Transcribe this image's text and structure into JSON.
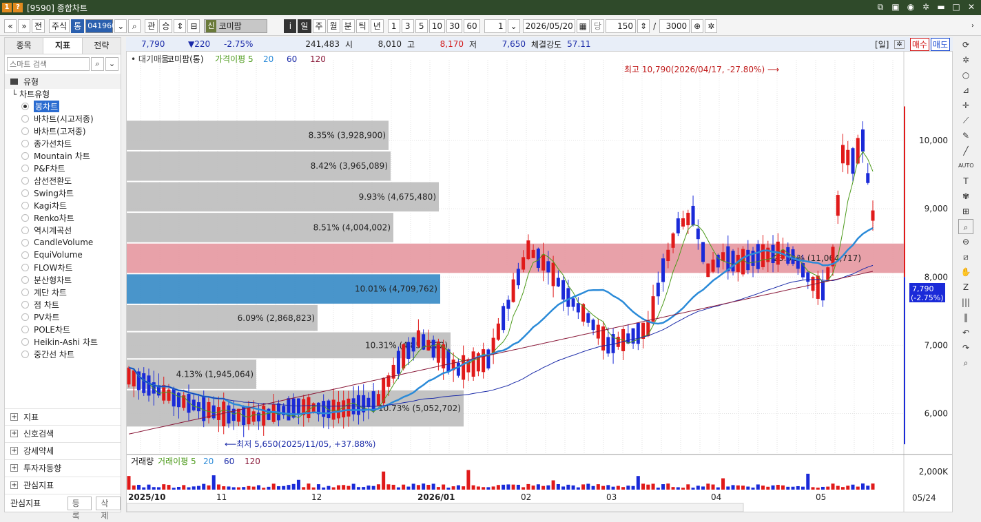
{
  "window": {
    "title": "[9590] 종합차트",
    "icon1": "1",
    "icon2": "?",
    "buttons": [
      "restore-icon",
      "image-icon",
      "camera-icon",
      "gear-icon",
      "minimize-icon",
      "maximize-icon",
      "close-icon"
    ]
  },
  "toolbar": {
    "prev": "«",
    "down": "»",
    "jeon": "전",
    "stock_type": "주식",
    "tong": "통",
    "code": "041960",
    "gwan": "관",
    "seung": "승",
    "tag": "신",
    "stock_name": "코미팜",
    "info": "i",
    "periods": [
      "일",
      "주",
      "월",
      "분",
      "틱",
      "년"
    ],
    "active_period": "일",
    "minutes": [
      "1",
      "3",
      "5",
      "10",
      "30",
      "60"
    ],
    "interval": "1",
    "date": "2026/05/20",
    "dang": "당",
    "count": "150",
    "slash": "/",
    "total": "3000"
  },
  "left": {
    "tabs": [
      "종목",
      "지표",
      "전략"
    ],
    "active_tab": "지표",
    "search_placeholder": "스마트 검색",
    "group": "유형",
    "tree_title": "차트유형",
    "chart_types": [
      "봉차트",
      "바차트(시고저종)",
      "바차트(고저종)",
      "종가선차트",
      "Mountain 차트",
      "P&F차트",
      "삼선전환도",
      "Swing차트",
      "Kagi차트",
      "Renko차트",
      "역시계곡선",
      "CandleVolume",
      "EquiVolume",
      "FLOW차트",
      "분산형차트",
      "계단 차트",
      "점 차트",
      "PV차트",
      "POLE차트",
      "Heikin-Ashi 차트",
      "중간선 차트"
    ],
    "selected_type": "봉차트",
    "bottom_groups": [
      "지표",
      "신호검색",
      "강세약세",
      "투자자동향",
      "관심지표"
    ],
    "footer_label": "관심지표",
    "btn_register": "등록",
    "btn_delete": "삭제"
  },
  "quote": {
    "price": "7,790",
    "change": "▼220",
    "rate": "-2.75%",
    "volume": "241,483",
    "open_label": "시",
    "open": "8,010",
    "high_label": "고",
    "high": "8,170",
    "low_label": "저",
    "low": "7,650",
    "strength_label": "체결강도",
    "strength": "57.11",
    "period_label": "[일]",
    "buy": "매수",
    "sell": "매도"
  },
  "chart_data": {
    "type": "candlestick",
    "legend": [
      "대기매물",
      "코미팜(통)",
      "가격이평 5",
      "20",
      "60",
      "120"
    ],
    "legend_colors": [
      "#333333",
      "#111111",
      "#4c9a1a",
      "#2a8ad8",
      "#1a2aa8",
      "#8a1a3a"
    ],
    "volume_legend": [
      "거래량",
      "거래이평 5",
      "20",
      "60",
      "120"
    ],
    "y_ticks": [
      10000,
      9000,
      8000,
      7000,
      6000
    ],
    "y_tick_labels": [
      "10,000",
      "9,000",
      "8,000",
      "7,000",
      "6,000"
    ],
    "vol_tick_label": "2,000K",
    "ylim": [
      5400,
      11100
    ],
    "x_labels": [
      "2025/10",
      "11",
      "12",
      "2026/01",
      "02",
      "03",
      "04",
      "05"
    ],
    "last_date_label": "05/24",
    "current_price_label": "7,790",
    "current_rate_label": "(-2.75%)",
    "max_annotation": "최고 10,790(2026/04/17, -27.80%)",
    "min_annotation": "최저 5,650(2025/11/05, +37.88%)",
    "volume_profile": [
      {
        "low": 6800,
        "high": 7200,
        "label": "10.31% (4,855,222)"
      },
      {
        "low": 7200,
        "high": 7600,
        "label": "6.09% (2,868,823)"
      },
      {
        "low": 7600,
        "high": 8050,
        "label": "10.01% (4,709,762)"
      },
      {
        "low": 8050,
        "high": 8500,
        "label": "23.51% (11,064,717)"
      },
      {
        "low": 8500,
        "high": 8950,
        "label": "8.51% (4,004,002)"
      },
      {
        "low": 8950,
        "high": 9400,
        "label": "9.93% (4,675,480)"
      },
      {
        "low": 9400,
        "high": 9850,
        "label": "8.42% (3,965,089)"
      },
      {
        "low": 9850,
        "high": 10300,
        "label": "8.35% (3,928,900)"
      },
      {
        "low": 6350,
        "high": 6800,
        "label": "4.13% (1,945,064)"
      },
      {
        "low": 5800,
        "high": 6350,
        "label": "10.73% (5,052,702)"
      }
    ]
  }
}
